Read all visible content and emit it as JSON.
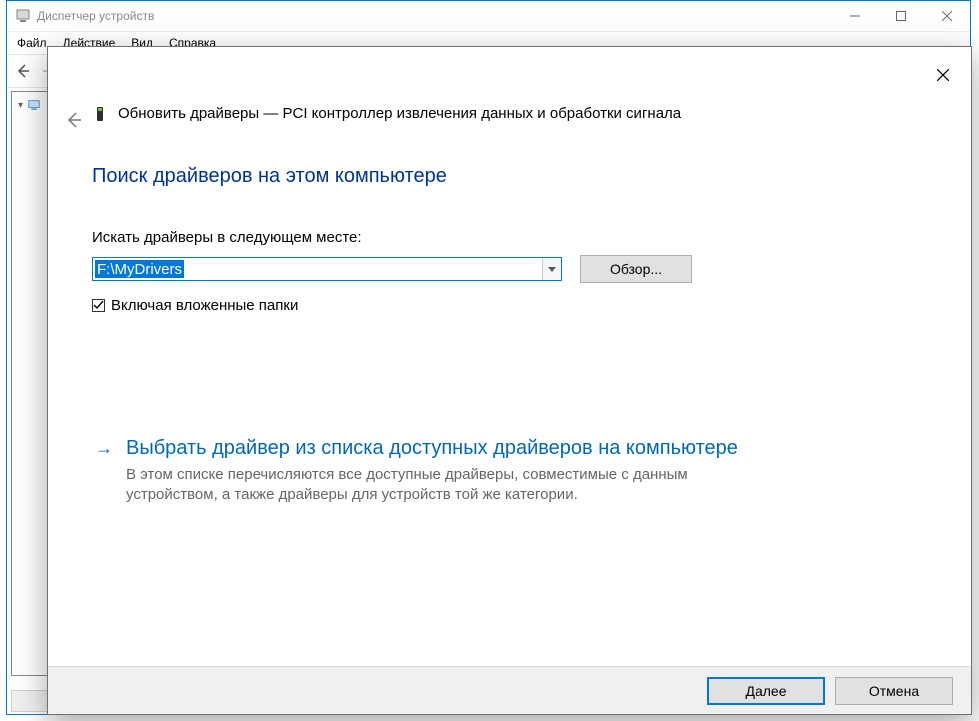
{
  "parentWindow": {
    "title": "Диспетчер устройств",
    "menu": {
      "file": "Файл",
      "action": "Действие",
      "view": "Вид",
      "help": "Справка"
    }
  },
  "wizard": {
    "headerText": "Обновить драйверы — PCI контроллер извлечения данных и обработки сигнала",
    "sectionTitle": "Поиск драйверов на этом компьютере",
    "locationLabel": "Искать драйверы в следующем месте:",
    "pathValue": "F:\\MyDrivers",
    "browseLabel": "Обзор...",
    "includeSubfolders": "Включая вложенные папки",
    "pickFromList": {
      "title": "Выбрать драйвер из списка доступных драйверов на компьютере",
      "desc": "В этом списке перечисляются все доступные драйверы, совместимые с данным устройством, а также драйверы для устройств той же категории."
    },
    "buttons": {
      "next": "Далее",
      "cancel": "Отмена"
    }
  }
}
